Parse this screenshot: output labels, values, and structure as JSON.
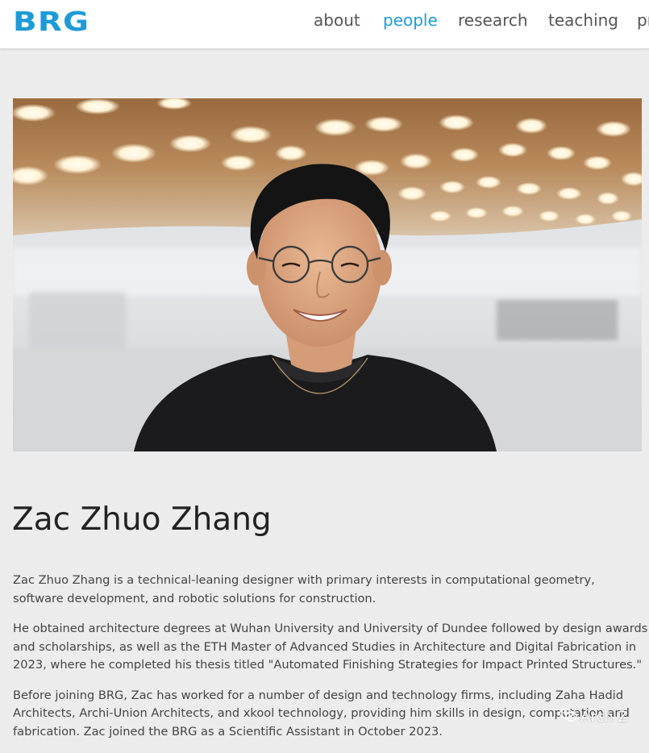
{
  "header": {
    "logo_text": "BRG",
    "nav": [
      {
        "label": "about",
        "active": false
      },
      {
        "label": "people",
        "active": true
      },
      {
        "label": "research",
        "active": false
      },
      {
        "label": "teaching",
        "active": false
      },
      {
        "label": "pr",
        "active": false
      }
    ]
  },
  "profile": {
    "name": "Zac Zhuo Zhang",
    "photo_icon": "portrait-photo",
    "bio": [
      "Zac Zhuo Zhang is a technical-leaning designer with primary interests in computational geometry, software development, and robotic solutions for construction.",
      "He obtained architecture degrees at Wuhan University and University of Dundee followed by design awards and scholarships, as well as the ETH Master of Advanced Studies in Architecture and Digital Fabrication in 2023, where he completed his thesis titled \"Automated Finishing Strategies for Impact Printed Structures.\"",
      "Before joining BRG, Zac has worked for a number of design and technology firms, including Zaha Hadid Architects, Archi-Union Architects, and xkool technology, providing him skills in design, computation and fabrication. Zac joined the BRG as a Scientific Assistant in October 2023."
    ]
  },
  "watermark": {
    "icon": "wechat-icon",
    "text": "Arch Z"
  },
  "colors": {
    "accent": "#1e9bd7",
    "background": "#ececec",
    "header_bg": "#ffffff",
    "text": "#333333"
  }
}
